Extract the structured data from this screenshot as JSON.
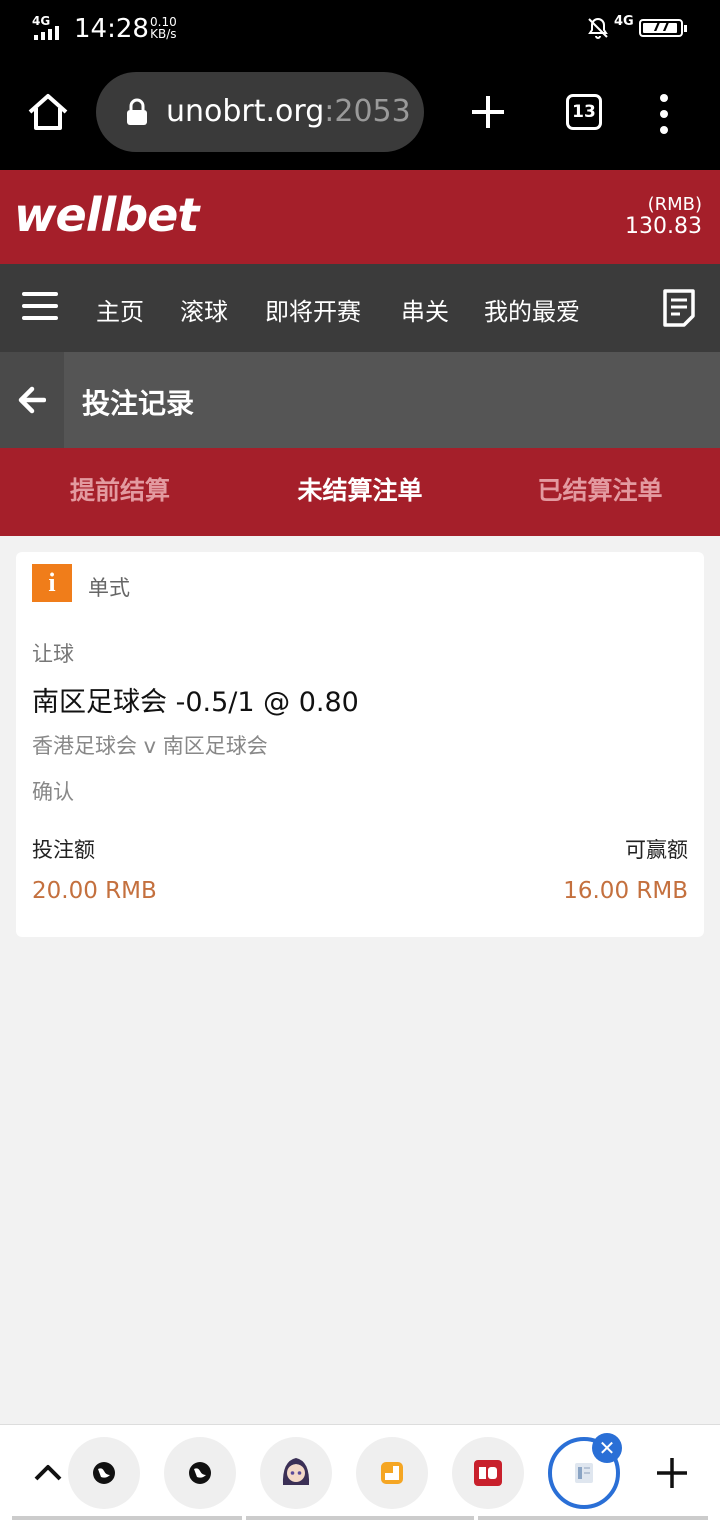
{
  "status_bar": {
    "network": "4G",
    "time": "14:28",
    "speed_value": "0.10",
    "speed_unit": "KB/s",
    "network_right": "4G",
    "battery": "77"
  },
  "browser": {
    "url_host": "unobrt.org",
    "url_port": ":2053",
    "tab_count": "13"
  },
  "site": {
    "logo": "wellbet",
    "currency": "(RMB)",
    "balance": "130.83"
  },
  "nav": {
    "items": [
      "主页",
      "滚球",
      "即将开赛",
      "串关",
      "我的最爱"
    ]
  },
  "page": {
    "title": "投注记录"
  },
  "tabs": [
    {
      "label": "提前结算",
      "active": false
    },
    {
      "label": "未结算注单",
      "active": true
    },
    {
      "label": "已结算注单",
      "active": false
    }
  ],
  "bet": {
    "info_glyph": "i",
    "type": "单式",
    "market": "让球",
    "selection": "南区足球会 -0.5/1 @ 0.80",
    "match": "香港足球会 v 南区足球会",
    "status": "确认",
    "stake_label": "投注额",
    "win_label": "可赢额",
    "stake": "20.00 RMB",
    "to_win": "16.00 RMB"
  },
  "colors": {
    "brand_red": "#a51f2a",
    "nav_dark": "#3b3b3b",
    "accent_orange": "#f07d1a",
    "amount": "#c4703e",
    "active_tab_ring": "#2a6fd6"
  },
  "bottom_bar": {
    "tab_icons": [
      "globe-icon",
      "globe-icon",
      "anime-avatar-icon",
      "orange-app-icon",
      "red-app-icon",
      "document-icon"
    ]
  }
}
